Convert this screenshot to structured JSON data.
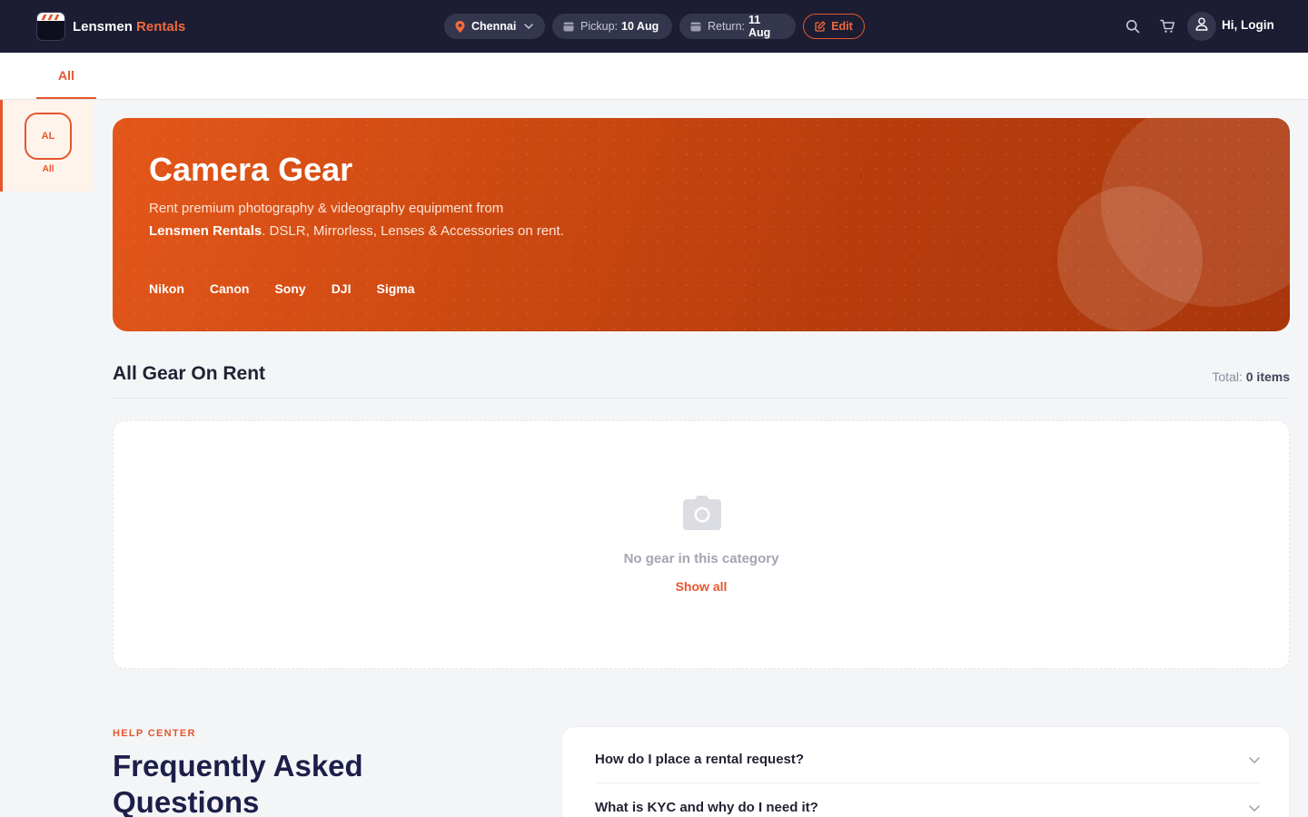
{
  "brand": {
    "name": "Lensmen",
    "name_accent": "Rentals"
  },
  "header": {
    "city": "Chennai",
    "pickup_label": "Pickup:",
    "pickup_value": "10 Aug",
    "return_label": "Return:",
    "return_value": "11 Aug",
    "edit_label": "Edit",
    "login_label": "Hi, Login"
  },
  "tabs": [
    {
      "label": "All",
      "active": true
    }
  ],
  "sidebar": {
    "items": [
      {
        "badge": "AL",
        "label": "All",
        "active": true
      }
    ]
  },
  "hero": {
    "title": "Camera Gear",
    "desc_prefix": "Rent premium photography & videography equipment from ",
    "desc_brand": "Lensmen Rentals",
    "desc_suffix": ". DSLR, Mirrorless, Lenses & Accessories on rent.",
    "brands": [
      "Nikon",
      "Canon",
      "Sony",
      "DJI",
      "Sigma"
    ]
  },
  "listing": {
    "title": "All Gear On Rent",
    "total_label": "Total:",
    "total_value": "0 items",
    "empty_text": "No gear in this category",
    "show_all": "Show all"
  },
  "faq": {
    "eyebrow": "HELP CENTER",
    "title": "Frequently Asked Questions",
    "questions": [
      "How do I place a rental request?",
      "What is KYC and why do I need it?"
    ]
  },
  "colors": {
    "accent": "#e4572e",
    "navbar": "#1c1d33",
    "hero_start": "#e4571a",
    "hero_end": "#a9360b"
  },
  "icons": [
    "location-pin-icon",
    "chevron-down-icon",
    "calendar-icon",
    "edit-icon",
    "search-icon",
    "cart-icon",
    "user-icon",
    "camera-icon"
  ]
}
